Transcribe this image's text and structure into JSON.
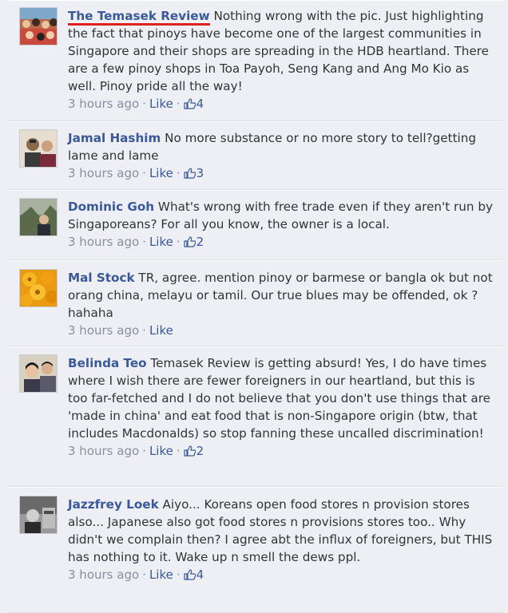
{
  "comments": [
    {
      "author": "The Temasek Review",
      "text": " Nothing wrong with the pic. Just highlighting the fact that pinoys have become one of the largest communities in Singapore and their shops are spreading in the HDB heartland. There are a few pinoy shops in Toa Payoh, Seng Kang and Ang Mo Kio as well. Pinoy pride all the way!",
      "time": "3 hours ago",
      "like_label": "Like",
      "likes": "4"
    },
    {
      "author": "Jamal Hashim",
      "text": " No more substance or no more story to tell?getting lame and lame",
      "time": "3 hours ago",
      "like_label": "Like",
      "likes": "3"
    },
    {
      "author": "Dominic Goh",
      "text": " What's wrong with free trade even if they aren't run by Singaporeans? For all you know, the owner is a local.",
      "time": "3 hours ago",
      "like_label": "Like",
      "likes": "2"
    },
    {
      "author": "Mal Stock",
      "text": " TR, agree. mention pinoy or barmese or bangla ok but not orang china, melayu or tamil. Our true blues may be offended, ok ? hahaha",
      "time": "3 hours ago",
      "like_label": "Like",
      "likes": ""
    },
    {
      "author": "Belinda Teo",
      "text": " Temasek Review is getting absurd! Yes, I do have times where I wish there are fewer foreigners in our heartland, but this is too far-fetched and I do not believe that you don't use things that are 'made in china' and eat food that is non-Singapore origin (btw, that includes Macdonalds) so stop fanning these uncalled discrimination!",
      "time": "3 hours ago",
      "like_label": "Like",
      "likes": "2"
    },
    {
      "author": "Jazzfrey Loek",
      "text": " Aiyo... Koreans open food stores n provision stores also... Japanese also got food stores n provisions stores too.. Why didn't we complain then? I agree abt the influx of foreigners, but THIS has nothing to it. Wake up n smell the dews ppl.",
      "time": "3 hours ago",
      "like_label": "Like",
      "likes": "4"
    }
  ],
  "colors": {
    "link": "#3b5998",
    "meta": "#8a8f9e",
    "background": "#edeff4",
    "underline": "#e02020"
  }
}
